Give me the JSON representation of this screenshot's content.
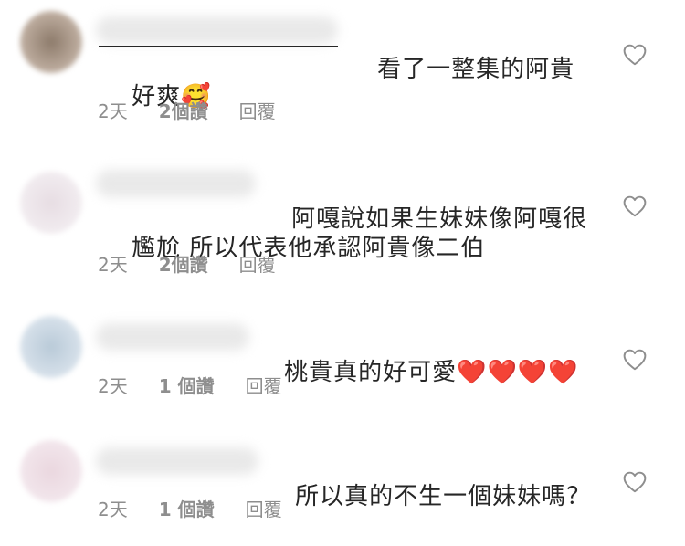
{
  "comments": [
    {
      "text_line1": "看了一整集的阿貴",
      "text_line2": "好爽",
      "emoji": "🥰",
      "time": "2天",
      "likes": "2個讚",
      "reply": "回覆"
    },
    {
      "text_line1": "阿嘎說如果生妹妹像阿嘎很",
      "text_line2": "尷尬 所以代表他承認阿貴像二伯",
      "time": "2天",
      "likes": "2個讚",
      "reply": "回覆"
    },
    {
      "text_line1": "桃貴真的好可愛",
      "hearts": "❤️❤️❤️❤️",
      "time": "2天",
      "likes": "1 個讚",
      "reply": "回覆"
    },
    {
      "text_line1": "所以真的不生一個妹妹嗎？",
      "time": "2天",
      "likes": "1 個讚",
      "reply": "回覆"
    }
  ],
  "icons": {
    "like": "heart-outline-icon"
  }
}
